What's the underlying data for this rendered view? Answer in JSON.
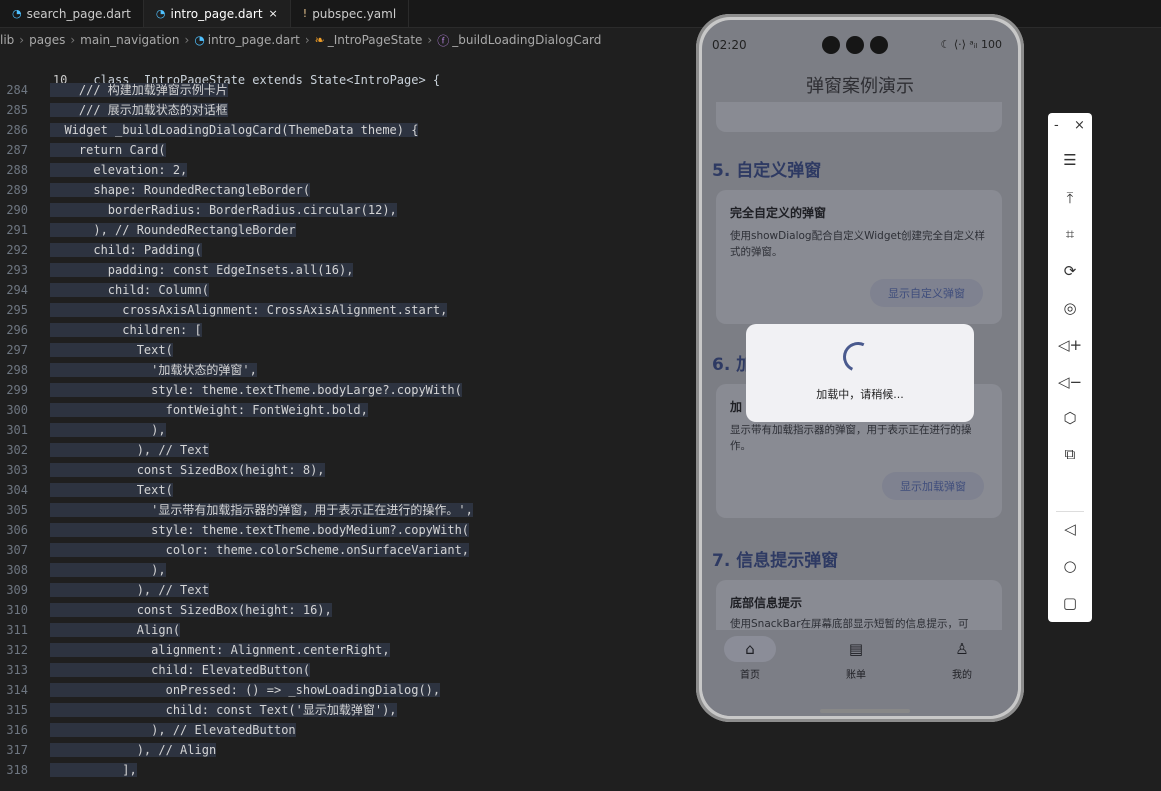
{
  "tabs": [
    {
      "icon": "dart-icon",
      "label": "search_page.dart",
      "active": false
    },
    {
      "icon": "dart-icon",
      "label": "intro_page.dart",
      "active": true,
      "close": "×"
    },
    {
      "icon": "yaml-icon",
      "label": "pubspec.yaml",
      "active": false,
      "prefix": "!"
    }
  ],
  "breadcrumb": [
    "lib",
    "pages",
    "main_navigation",
    "intro_page.dart",
    "_IntroPageState",
    "_buildLoadingDialogCard"
  ],
  "sticky_line": {
    "num": "10",
    "text": "class _IntroPageState extends State<IntroPage> {"
  },
  "code_lines": [
    {
      "num": "284",
      "text": "    /// 构建加载弹窗示例卡片"
    },
    {
      "num": "285",
      "text": "    /// 展示加载状态的对话框"
    },
    {
      "num": "286",
      "text": "  Widget _buildLoadingDialogCard(ThemeData theme) {"
    },
    {
      "num": "287",
      "text": "    return Card("
    },
    {
      "num": "288",
      "text": "      elevation: 2,"
    },
    {
      "num": "289",
      "text": "      shape: RoundedRectangleBorder("
    },
    {
      "num": "290",
      "text": "        borderRadius: BorderRadius.circular(12),"
    },
    {
      "num": "291",
      "text": "      ), // RoundedRectangleBorder"
    },
    {
      "num": "292",
      "text": "      child: Padding("
    },
    {
      "num": "293",
      "text": "        padding: const EdgeInsets.all(16),"
    },
    {
      "num": "294",
      "text": "        child: Column("
    },
    {
      "num": "295",
      "text": "          crossAxisAlignment: CrossAxisAlignment.start,"
    },
    {
      "num": "296",
      "text": "          children: ["
    },
    {
      "num": "297",
      "text": "            Text("
    },
    {
      "num": "298",
      "text": "              '加载状态的弹窗',"
    },
    {
      "num": "299",
      "text": "              style: theme.textTheme.bodyLarge?.copyWith("
    },
    {
      "num": "300",
      "text": "                fontWeight: FontWeight.bold,"
    },
    {
      "num": "301",
      "text": "              ),"
    },
    {
      "num": "302",
      "text": "            ), // Text"
    },
    {
      "num": "303",
      "text": "            const SizedBox(height: 8),"
    },
    {
      "num": "304",
      "text": "            Text("
    },
    {
      "num": "305",
      "text": "              '显示带有加载指示器的弹窗，用于表示正在进行的操作。',"
    },
    {
      "num": "306",
      "text": "              style: theme.textTheme.bodyMedium?.copyWith("
    },
    {
      "num": "307",
      "text": "                color: theme.colorScheme.onSurfaceVariant,"
    },
    {
      "num": "308",
      "text": "              ),"
    },
    {
      "num": "309",
      "text": "            ), // Text"
    },
    {
      "num": "310",
      "text": "            const SizedBox(height: 16),"
    },
    {
      "num": "311",
      "text": "            Align("
    },
    {
      "num": "312",
      "text": "              alignment: Alignment.centerRight,"
    },
    {
      "num": "313",
      "text": "              child: ElevatedButton("
    },
    {
      "num": "314",
      "text": "                onPressed: () => _showLoadingDialog(),"
    },
    {
      "num": "315",
      "text": "                child: const Text('显示加载弹窗'),"
    },
    {
      "num": "316",
      "text": "              ), // ElevatedButton"
    },
    {
      "num": "317",
      "text": "            ), // Align"
    },
    {
      "num": "318",
      "text": "          ],"
    }
  ],
  "phone": {
    "status_time": "02:20",
    "status_right": "☾ ⟨·⟩ ᵃᵢₗ 100",
    "app_title": "弹窗案例演示",
    "sections": [
      {
        "title": "5. 自定义弹窗",
        "card_title": "完全自定义的弹窗",
        "card_desc": "使用showDialog配合自定义Widget创建完全自定义样式的弹窗。",
        "button": "显示自定义弹窗"
      },
      {
        "title": "6. 加",
        "card_title": "加",
        "card_desc": "显示带有加载指示器的弹窗，用于表示正在进行的操作。",
        "button": "显示加载弹窗"
      },
      {
        "title": "7. 信息提示弹窗",
        "card_title": "底部信息提示",
        "card_desc": "使用SnackBar在屏幕底部显示短暂的信息提示，可"
      }
    ],
    "dialog_text": "加载中，请稍候...",
    "nav": [
      {
        "icon": "home-icon",
        "label": "首页",
        "active": true
      },
      {
        "icon": "ledger-icon",
        "label": "账单",
        "active": false
      },
      {
        "icon": "person-icon",
        "label": "我的",
        "active": false
      }
    ]
  },
  "emulator_toolbar": {
    "minimize": "-",
    "close": "×",
    "icons": [
      "menu-icon",
      "pin-top-icon",
      "crop-icon",
      "rotate-icon",
      "location-icon",
      "volume-up-icon",
      "volume-down-icon",
      "rotate-device-icon",
      "screenshot-icon",
      "back-icon",
      "home-circle-icon",
      "recents-icon"
    ]
  }
}
